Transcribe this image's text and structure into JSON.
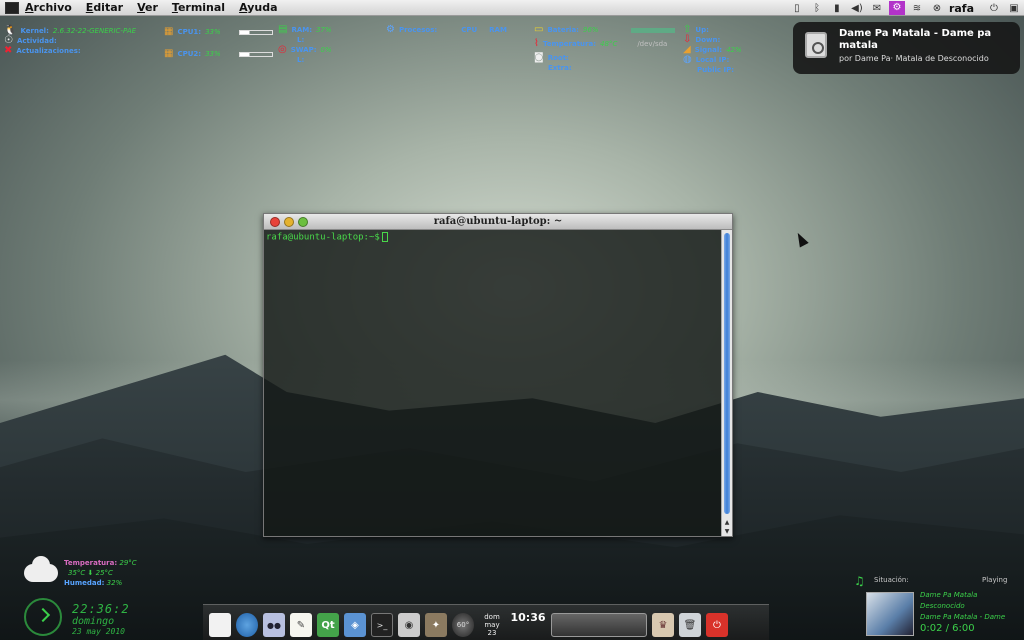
{
  "menubar": {
    "items": [
      "Archivo",
      "Editar",
      "Ver",
      "Terminal",
      "Ayuda"
    ],
    "user": "rafa",
    "tray_icons": [
      "phone-icon",
      "bluetooth-icon",
      "battery-icon",
      "volume-icon",
      "mail-icon",
      "gear-icon",
      "wifi-icon",
      "user-icon",
      "power-icon",
      "window-icon"
    ]
  },
  "conky": {
    "system": {
      "kernel_label": "Kernel:",
      "kernel_value": "2.6.32-22-GENERIC-PAE",
      "activity_label": "Actividad:",
      "activity_value": "",
      "updates_label": "Actualizaciones:",
      "updates_value": ""
    },
    "cpu": {
      "cpu1_label": "CPU1:",
      "cpu1_value": "33%",
      "cpu2_label": "CPU2:",
      "cpu2_value": "33%"
    },
    "mem": {
      "ram_label": "RAM:",
      "ram_value": "37%",
      "ram_sub": "L:",
      "swap_label": "SWAP:",
      "swap_value": "0%",
      "swap_sub": "L:"
    },
    "procs": {
      "label": "Procesos:",
      "cpu_header": "CPU",
      "ram_header": "RAM"
    },
    "power": {
      "battery_label": "Bateria:",
      "battery_value": "96%",
      "temp_label": "Temperatura:",
      "temp_value": "48°C",
      "dev_label": "/dev/sda",
      "root_label": "Root:",
      "extra_label": "Extra:"
    },
    "net": {
      "up_label": "Up:",
      "down_label": "Down:",
      "signal_label": "Signal:",
      "signal_value": "42%",
      "local_label": "Local IP:",
      "public_label": "Public IP:"
    }
  },
  "notification": {
    "title": "Dame Pa Matala - Dame pa matala",
    "body": "por Dame Pa· Matala de Desconocido"
  },
  "terminal": {
    "title": "rafa@ubuntu-laptop: ~",
    "prompt": "rafa@ubuntu-laptop:~$"
  },
  "weather": {
    "temp_label": "Temperatura:",
    "temp_value": "29°C",
    "range_value": "35°C ⬇ 25°C",
    "humidity_label": "Humedad:",
    "humidity_value": "32%"
  },
  "clock": {
    "time": "22:36:2",
    "day": "domingo",
    "date": "23 may 2010"
  },
  "dock": {
    "date_top": "dom",
    "date_bottom": "may 23",
    "time": "10:36",
    "gauge_label": "60°"
  },
  "player": {
    "situation_label": "Situación:",
    "state": "Playing",
    "track": "Dame Pa Matala",
    "artist": "Desconocido",
    "line3": "Dame Pa Matala - Dame",
    "position": "0:02 / 6:00"
  }
}
